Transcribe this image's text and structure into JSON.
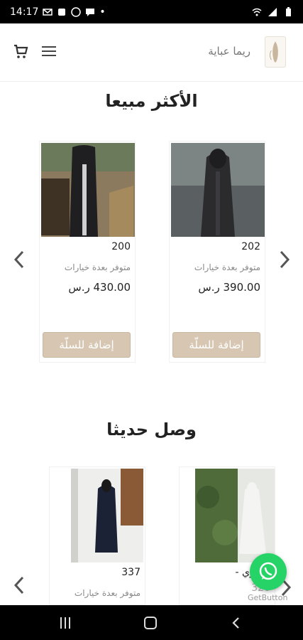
{
  "status": {
    "time": "14:17",
    "dot": "•"
  },
  "header": {
    "brand": "ريما عباية"
  },
  "best_sellers": {
    "title": "الأكثر مبيعا",
    "products": [
      {
        "name": "202",
        "note": "متوفر بعدة خيارات",
        "price": "390.00 ر.س",
        "button": "إضافة للسلّة"
      },
      {
        "name": "200",
        "note": "متوفر بعدة خيارات",
        "price": "430.00 ر.س",
        "button": "إضافة للسلّة"
      }
    ]
  },
  "new_arrivals": {
    "title": "وصل حديثا",
    "products": [
      {
        "name": "ا فوري -",
        "price": "320"
      },
      {
        "name": "337",
        "note": "متوفر بعدة خيارات"
      }
    ]
  },
  "whatsapp": {
    "caption": "GetButton"
  },
  "colors": {
    "accent": "#d6c6b2",
    "whatsapp": "#25d366"
  }
}
